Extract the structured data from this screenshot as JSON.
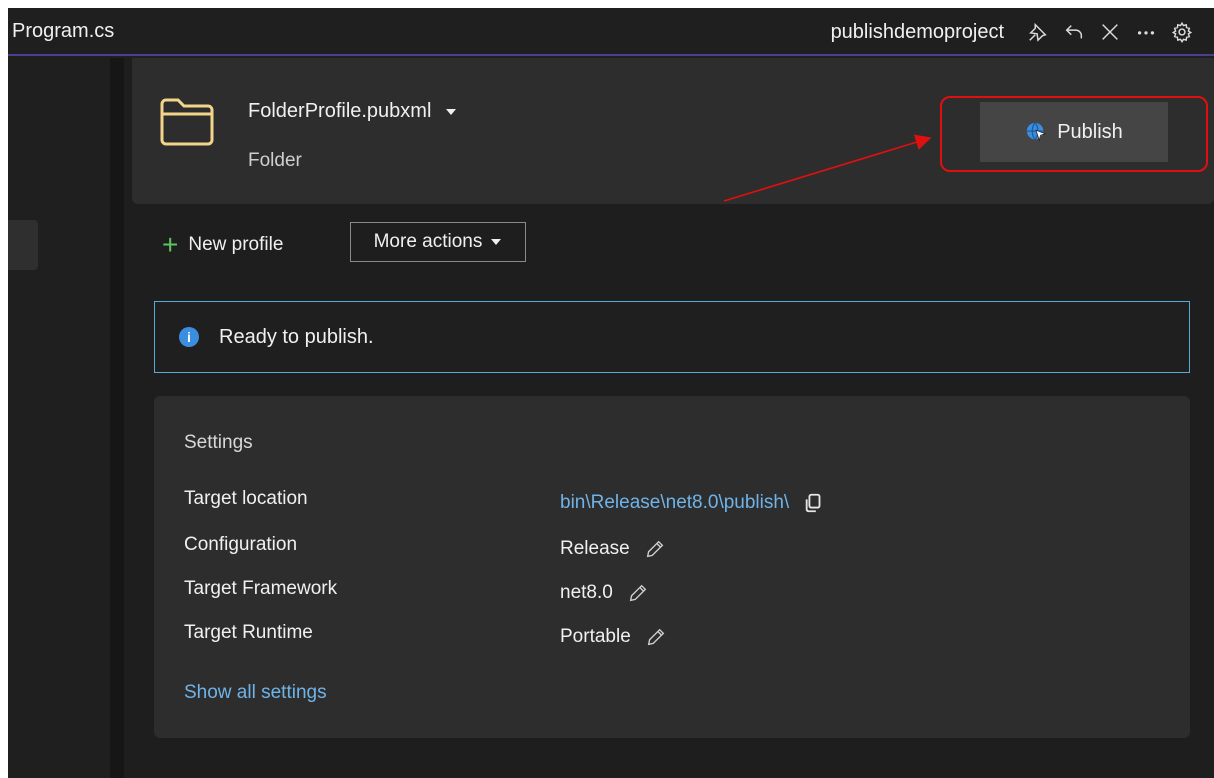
{
  "titlebar": {
    "tab_title": "Program.cs",
    "project_name": "publishdemoproject",
    "icons": [
      "pin-icon",
      "back-icon",
      "close-icon",
      "more-icon",
      "settings-icon"
    ]
  },
  "profile": {
    "name": "FolderProfile.pubxml",
    "type": "Folder",
    "publish_label": "Publish"
  },
  "actions": {
    "new_profile_label": "New profile",
    "more_actions_label": "More actions"
  },
  "banner": {
    "message": "Ready to publish."
  },
  "settings": {
    "title": "Settings",
    "rows": [
      {
        "label": "Target location",
        "value": "bin\\Release\\net8.0\\publish\\",
        "icon": "copy-icon"
      },
      {
        "label": "Configuration",
        "value": "Release",
        "icon": "edit-icon"
      },
      {
        "label": "Target Framework",
        "value": "net8.0",
        "icon": "edit-icon"
      },
      {
        "label": "Target Runtime",
        "value": "Portable",
        "icon": "edit-icon"
      }
    ],
    "show_all_label": "Show all settings"
  },
  "colors": {
    "highlight": "#e01010",
    "link": "#6fb3e8",
    "accent_green": "#5fc35f",
    "info_blue": "#3b8de0"
  }
}
